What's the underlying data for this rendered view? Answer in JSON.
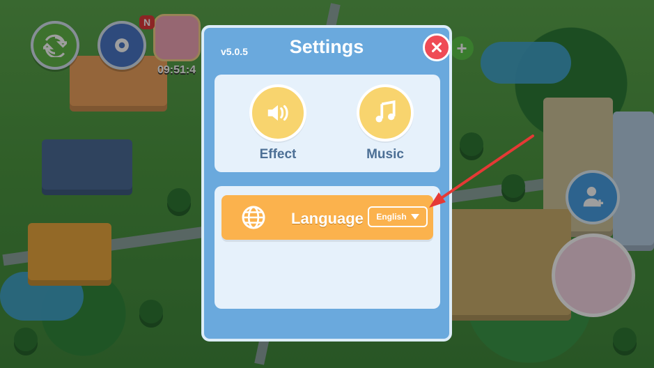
{
  "hud": {
    "new_label": "N",
    "timer": "09:51:4"
  },
  "modal": {
    "title": "Settings",
    "version": "v5.0.5"
  },
  "sound": {
    "effect_label": "Effect",
    "music_label": "Music"
  },
  "language": {
    "label": "Language",
    "selected": "English"
  },
  "colors": {
    "modal_bg": "#6aa9dd",
    "panel_bg": "#e6f1fb",
    "accent_orange": "#fbb24d",
    "close_red": "#ef4b55",
    "icon_yellow": "#f8d46e",
    "arrow_red": "#e53935"
  },
  "icons": {
    "refresh": "refresh-icon",
    "gear": "gear-icon",
    "gift": "gift-icon",
    "speaker": "speaker-icon",
    "music": "music-note-icon",
    "globe": "globe-icon",
    "close": "close-icon",
    "add_friend": "add-friend-icon"
  }
}
